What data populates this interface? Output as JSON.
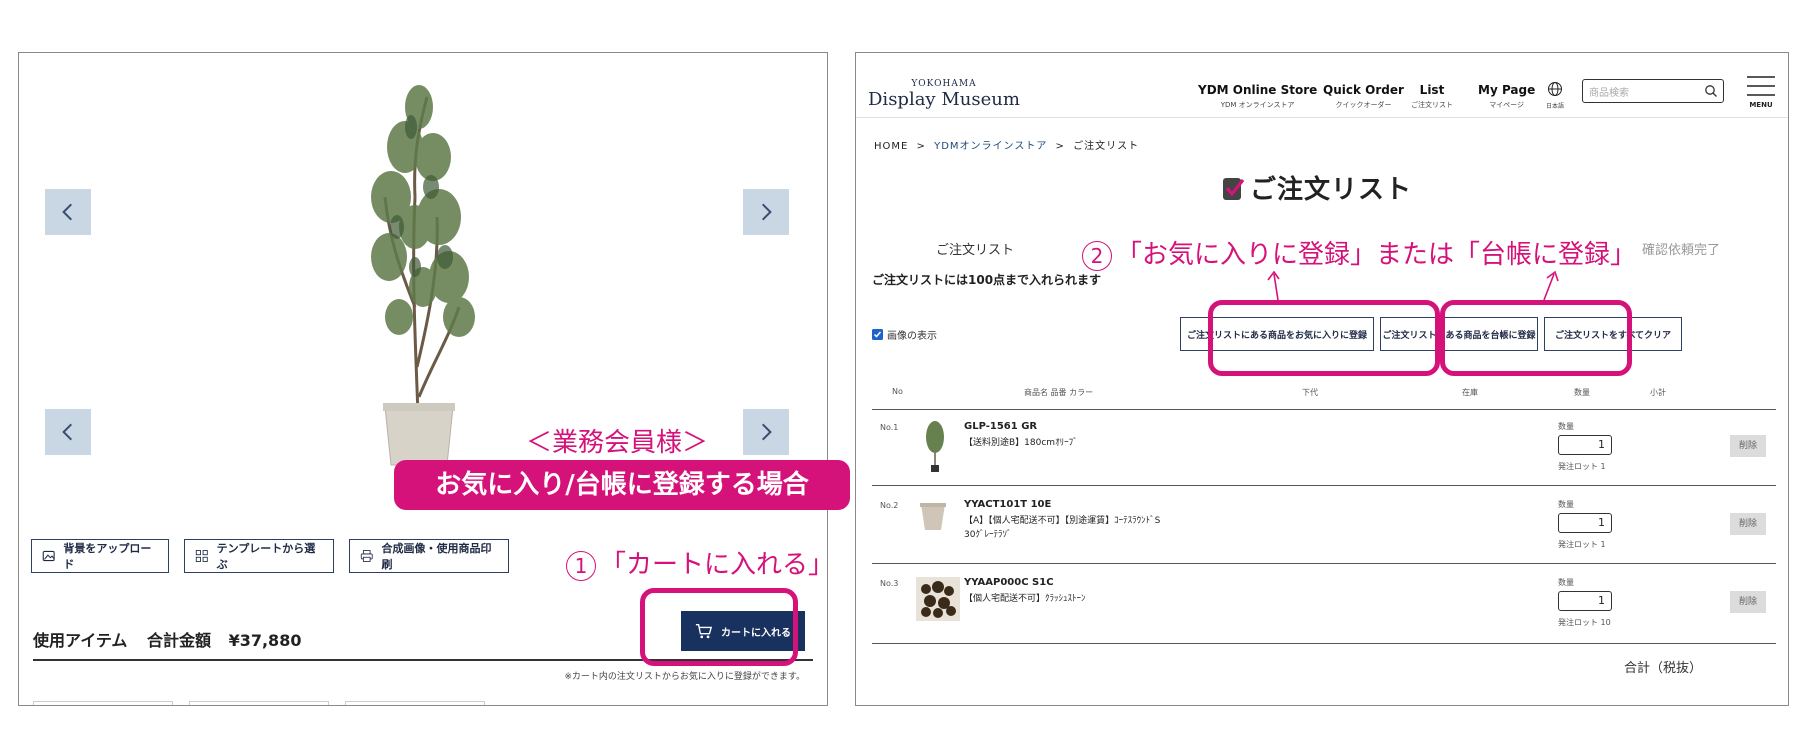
{
  "left": {
    "tools": {
      "upload": "背景をアップロード",
      "template": "テンプレートから選ぶ",
      "print": "合成画像・使用商品印刷"
    },
    "items_title": "使用アイテム",
    "total_label": "合計金額",
    "total_value": "¥37,880",
    "cart_button": "カートに入れる",
    "note": "※カート内の注文リストからお気に入りに登録ができます。"
  },
  "annotations": {
    "member": "＜業務会員様＞",
    "banner": "お気に入り/台帳に登録する場合",
    "step1_num": "1",
    "step1_text": "「カートに入れる」",
    "step2_num": "2",
    "step2_text": "「お気に入りに登録」または「台帳に登録」"
  },
  "header": {
    "logo_top": "YOKOHAMA",
    "logo_main": "Display Museum",
    "nav": [
      {
        "en": "YDM Online Store",
        "jp": "YDM オンラインストア"
      },
      {
        "en": "Quick Order",
        "jp": "クイックオーダー"
      },
      {
        "en": "List",
        "jp": "ご注文リスト"
      },
      {
        "en": "My Page",
        "jp": "マイページ"
      }
    ],
    "lang": "日本語",
    "search_placeholder": "商品検索",
    "menu": "MENU"
  },
  "breadcrumb": [
    "HOME",
    "YDMオンラインストア",
    "ご注文リスト"
  ],
  "page_title": "ご注文リスト",
  "steps": {
    "first": "ご注文リスト",
    "last": "確認依頼完了"
  },
  "limit_note": "ご注文リストには100点まで入れられます",
  "show_images": "画像の表示",
  "buttons": {
    "favorite": "ご注文リストにある商品をお気に入りに登録",
    "ledger": "ご注文リストにある商品を台帳に登録",
    "clear": "ご注文リストをすべてクリア"
  },
  "table_headers": {
    "no": "No",
    "product": "商品名 品番 カラー",
    "price": "下代",
    "stock": "在庫",
    "qty": "数量",
    "subtotal": "小計"
  },
  "rows": [
    {
      "no": "No.1",
      "code": "GLP-1561 GR",
      "desc1": "【送料別途B】180cmｵﾘｰﾌﾞ",
      "desc2": "",
      "qty_label": "数量",
      "qty": "1",
      "lot": "発注ロット 1",
      "delete": "削除"
    },
    {
      "no": "No.2",
      "code": "YYACT101T 10E",
      "desc1": "【A】【個人宅配送不可】【別途運賃】ｺｰﾃｽﾗｳﾝﾄﾞS",
      "desc2": "30ｸﾞﾚｰﾃﾗｿﾞ",
      "qty_label": "数量",
      "qty": "1",
      "lot": "発注ロット 1",
      "delete": "削除"
    },
    {
      "no": "No.3",
      "code": "YYAAP000C S1C",
      "desc1": "【個人宅配送不可】ｸﾗｯｼｭｽﾄｰﾝ",
      "desc2": "",
      "qty_label": "数量",
      "qty": "1",
      "lot": "発注ロット 10",
      "delete": "削除"
    }
  ],
  "total_label": "合計（税抜）",
  "colors": {
    "accent": "#d5127a",
    "navy": "#18315e",
    "nav_bg": "#c9d6e4"
  }
}
